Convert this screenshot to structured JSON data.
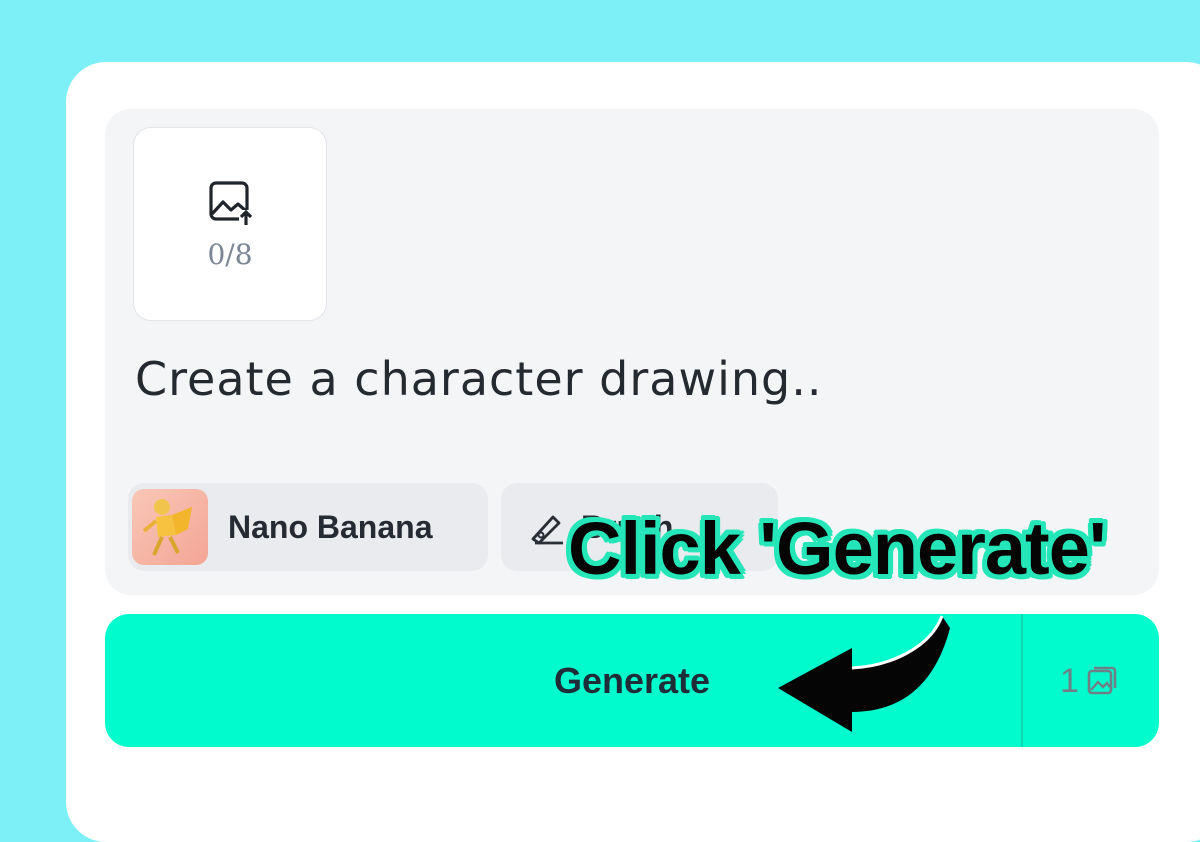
{
  "upload": {
    "count": "0/8",
    "icon": "image-upload-icon"
  },
  "prompt": {
    "text": "Create a character drawing.."
  },
  "model_chip": {
    "label": "Nano Banana"
  },
  "style_chip": {
    "label": "Brush",
    "icon": "pen-icon"
  },
  "generate": {
    "label": "Generate",
    "count": "1",
    "count_icon": "images-icon"
  },
  "overlay": {
    "text": "Click 'Generate'",
    "color": "#24e6b8"
  },
  "colors": {
    "background": "#7deff7",
    "accent": "#00fccd"
  }
}
